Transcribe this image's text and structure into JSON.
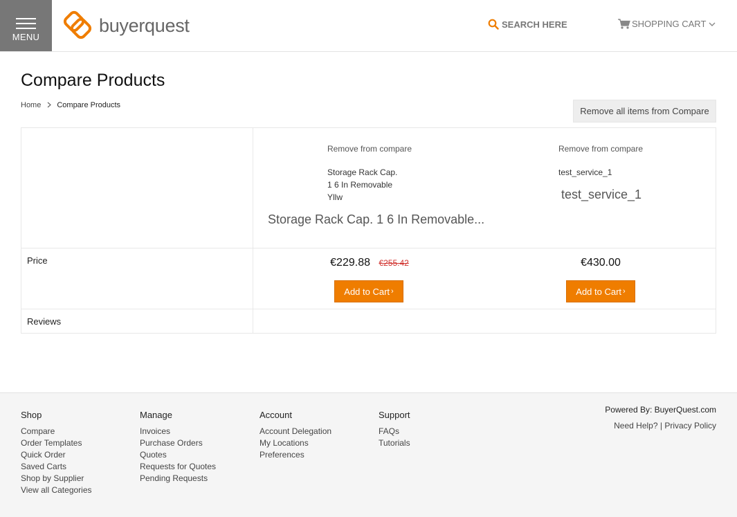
{
  "header": {
    "menu_label": "MENU",
    "logo_text": "buyerquest",
    "search_label": "SEARCH HERE",
    "cart_label": "SHOPPING CART"
  },
  "page": {
    "title": "Compare Products",
    "breadcrumb_home": "Home",
    "breadcrumb_sep": ">",
    "breadcrumb_current": "Compare Products",
    "remove_all_label": "Remove all items from Compare"
  },
  "compare": {
    "row_labels": {
      "price": "Price",
      "reviews": "Reviews"
    },
    "products": [
      {
        "remove_label": "Remove from compare",
        "short_name_lines": [
          "Storage Rack Cap.",
          "1 6 In Removable",
          "Yllw"
        ],
        "name": "Storage Rack Cap. 1 6 In Removable...",
        "price": "€229.88",
        "old_price": "€255.42",
        "add_to_cart": "Add to Cart",
        "add_arrow": "›"
      },
      {
        "remove_label": "Remove from compare",
        "short_name_lines": [
          "test_service_1"
        ],
        "name": "test_service_1",
        "price": "€430.00",
        "old_price": "",
        "add_to_cart": "Add to Cart",
        "add_arrow": "›"
      }
    ]
  },
  "footer": {
    "columns": [
      {
        "heading": "Shop",
        "links": [
          "Compare",
          "Order Templates",
          "Quick Order",
          "Saved Carts",
          "Shop by Supplier",
          "View all Categories"
        ]
      },
      {
        "heading": "Manage",
        "links": [
          "Invoices",
          "Purchase Orders",
          "Quotes",
          "Requests for Quotes",
          "Pending Requests"
        ]
      },
      {
        "heading": "Account",
        "links": [
          "Account Delegation",
          "My Locations",
          "Preferences"
        ]
      },
      {
        "heading": "Support",
        "links": [
          "FAQs",
          "Tutorials"
        ]
      }
    ],
    "powered_by": "Powered By: BuyerQuest.com",
    "need_help": "Need Help?",
    "help_sep": "|",
    "privacy": "Privacy Policy"
  },
  "colors": {
    "accent": "#ef7d00",
    "menu_bg": "#777777",
    "old_price": "#d0312d"
  },
  "icons": [
    "hamburger-icon",
    "buyerquest-logo-icon",
    "search-icon",
    "cart-icon",
    "chevron-down-icon",
    "chevron-right-icon"
  ]
}
